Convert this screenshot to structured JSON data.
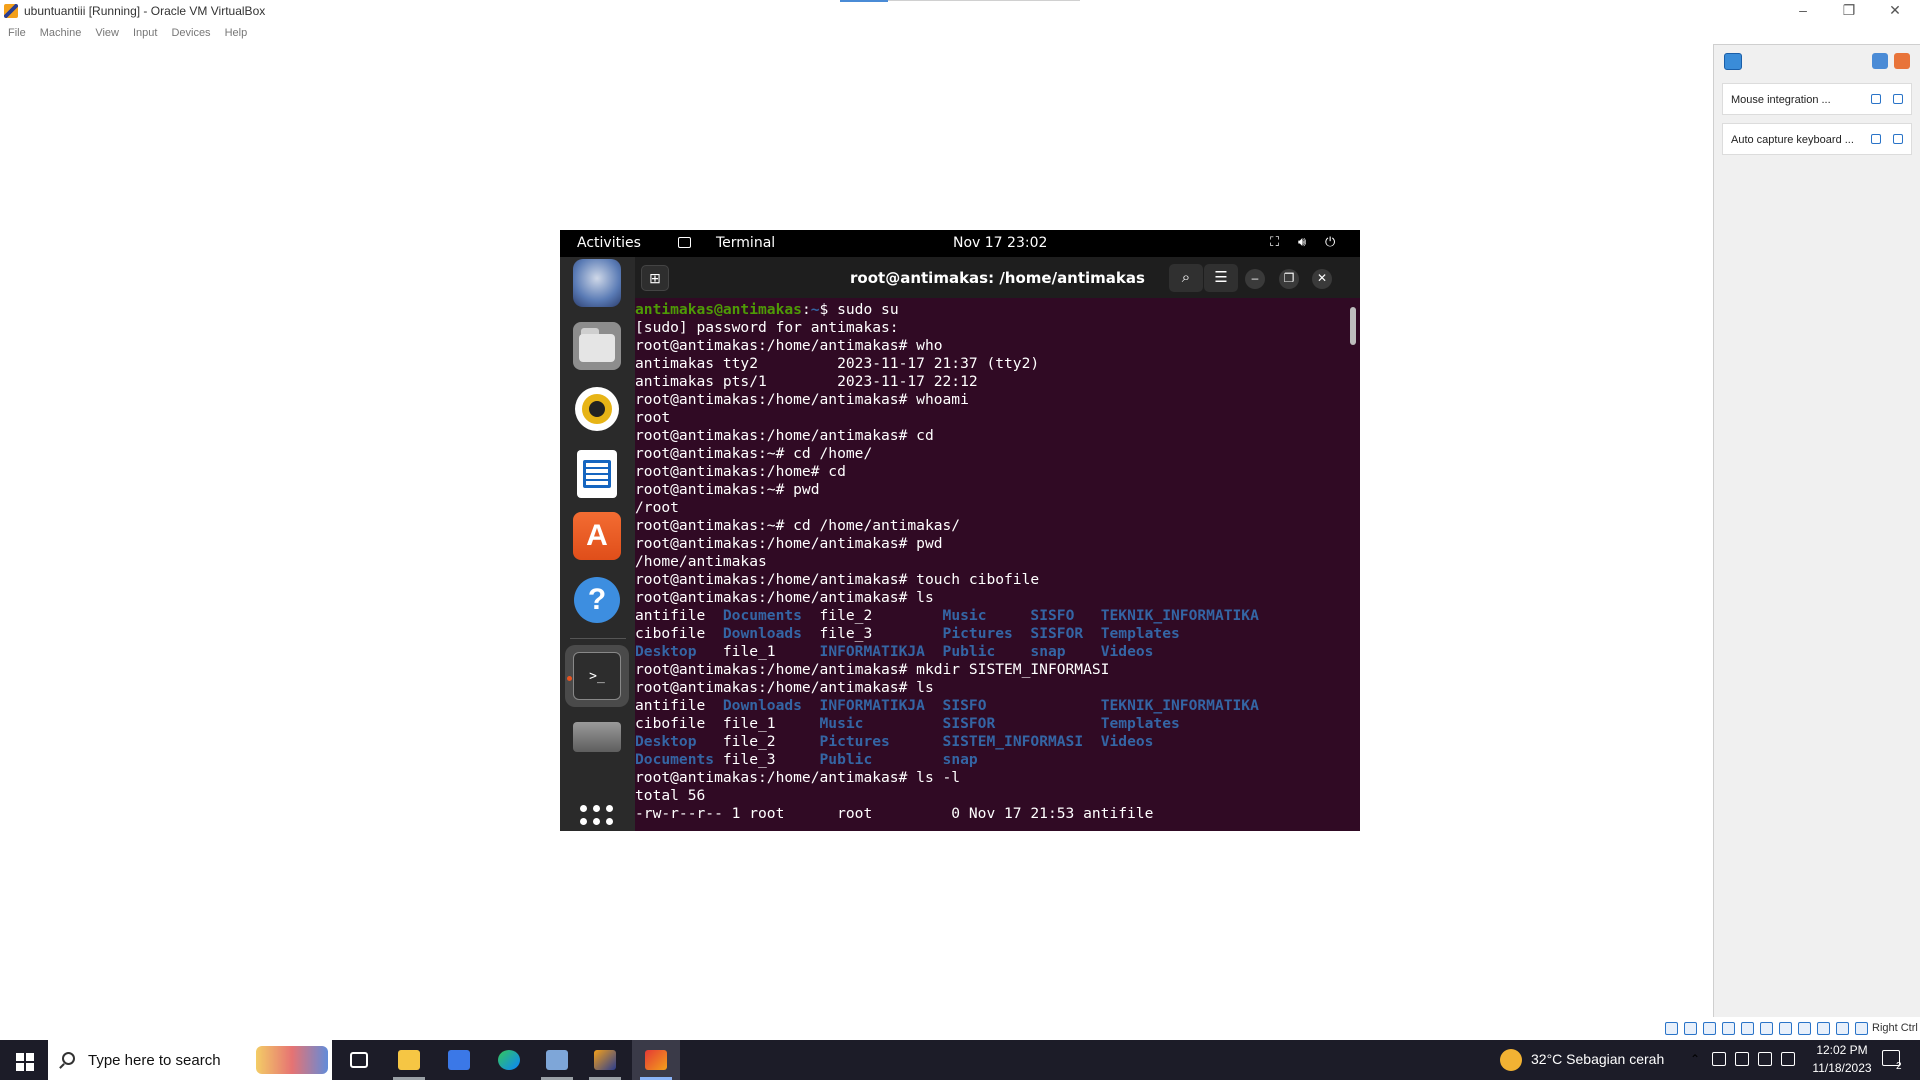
{
  "vbox": {
    "title": "ubuntuantiii [Running] - Oracle VM VirtualBox",
    "window_controls": {
      "minimize": "–",
      "restore": "❐",
      "close": "✕"
    },
    "menus": [
      "File",
      "Machine",
      "View",
      "Input",
      "Devices",
      "Help"
    ],
    "notifications": [
      {
        "label": "Mouse integration ..."
      },
      {
        "label": "Auto capture keyboard ..."
      }
    ],
    "host_key": "Right Ctrl"
  },
  "gnome": {
    "activities": "Activities",
    "app_menu": "Terminal",
    "clock": "Nov 17  23:02",
    "icons": [
      "network-icon",
      "volume-icon",
      "power-icon"
    ]
  },
  "dock": {
    "items": [
      "thunderbird-icon",
      "files-icon",
      "rhythmbox-icon",
      "libreoffice-writer-icon",
      "app-center-icon",
      "help-icon",
      "terminal-icon",
      "drive-icon",
      "show-apps-icon"
    ],
    "help_glyph": "?",
    "appcenter_glyph": "A",
    "terminal_glyph": ">_"
  },
  "terminal": {
    "title": "root@antimakas: /home/antimakas",
    "lines": [
      [
        {
          "t": "antimakas@antimakas",
          "c": "user"
        },
        {
          "t": ":"
        },
        {
          "t": "~",
          "c": "path"
        },
        {
          "t": "$ sudo su"
        }
      ],
      [
        {
          "t": "[sudo] password for antimakas:"
        }
      ],
      [
        {
          "t": "root@antimakas:/home/antimakas# who"
        }
      ],
      [
        {
          "t": "antimakas tty2         2023-11-17 21:37 (tty2)"
        }
      ],
      [
        {
          "t": "antimakas pts/1        2023-11-17 22:12"
        }
      ],
      [
        {
          "t": "root@antimakas:/home/antimakas# whoami"
        }
      ],
      [
        {
          "t": "root"
        }
      ],
      [
        {
          "t": "root@antimakas:/home/antimakas# cd"
        }
      ],
      [
        {
          "t": "root@antimakas:~# cd /home/"
        }
      ],
      [
        {
          "t": "root@antimakas:/home# cd"
        }
      ],
      [
        {
          "t": "root@antimakas:~# pwd"
        }
      ],
      [
        {
          "t": "/root"
        }
      ],
      [
        {
          "t": "root@antimakas:~# cd /home/antimakas/"
        }
      ],
      [
        {
          "t": "root@antimakas:/home/antimakas# pwd"
        }
      ],
      [
        {
          "t": "/home/antimakas"
        }
      ],
      [
        {
          "t": "root@antimakas:/home/antimakas# touch cibofile"
        }
      ],
      [
        {
          "t": "root@antimakas:/home/antimakas# ls"
        }
      ],
      [
        {
          "t": "antifile  "
        },
        {
          "t": "Documents",
          "c": "dir"
        },
        {
          "t": "  file_2        "
        },
        {
          "t": "Music",
          "c": "dir"
        },
        {
          "t": "     "
        },
        {
          "t": "SISFO",
          "c": "dir"
        },
        {
          "t": "   "
        },
        {
          "t": "TEKNIK_INFORMATIKA",
          "c": "dir"
        }
      ],
      [
        {
          "t": "cibofile  "
        },
        {
          "t": "Downloads",
          "c": "dir"
        },
        {
          "t": "  file_3        "
        },
        {
          "t": "Pictures",
          "c": "dir"
        },
        {
          "t": "  "
        },
        {
          "t": "SISFOR",
          "c": "dir"
        },
        {
          "t": "  "
        },
        {
          "t": "Templates",
          "c": "dir"
        }
      ],
      [
        {
          "t": "Desktop",
          "c": "dir"
        },
        {
          "t": "   file_1     "
        },
        {
          "t": "INFORMATIKJA",
          "c": "dir"
        },
        {
          "t": "  "
        },
        {
          "t": "Public",
          "c": "dir"
        },
        {
          "t": "    "
        },
        {
          "t": "snap",
          "c": "dir"
        },
        {
          "t": "    "
        },
        {
          "t": "Videos",
          "c": "dir"
        }
      ],
      [
        {
          "t": "root@antimakas:/home/antimakas# mkdir SISTEM_INFORMASI"
        }
      ],
      [
        {
          "t": "root@antimakas:/home/antimakas# ls"
        }
      ],
      [
        {
          "t": "antifile  "
        },
        {
          "t": "Downloads",
          "c": "dir"
        },
        {
          "t": "  "
        },
        {
          "t": "INFORMATIKJA",
          "c": "dir"
        },
        {
          "t": "  "
        },
        {
          "t": "SISFO",
          "c": "dir"
        },
        {
          "t": "             "
        },
        {
          "t": "TEKNIK_INFORMATIKA",
          "c": "dir"
        }
      ],
      [
        {
          "t": "cibofile  file_1     "
        },
        {
          "t": "Music",
          "c": "dir"
        },
        {
          "t": "         "
        },
        {
          "t": "SISFOR",
          "c": "dir"
        },
        {
          "t": "            "
        },
        {
          "t": "Templates",
          "c": "dir"
        }
      ],
      [
        {
          "t": "Desktop",
          "c": "dir"
        },
        {
          "t": "   file_2     "
        },
        {
          "t": "Pictures",
          "c": "dir"
        },
        {
          "t": "      "
        },
        {
          "t": "SISTEM_INFORMASI",
          "c": "dir"
        },
        {
          "t": "  "
        },
        {
          "t": "Videos",
          "c": "dir"
        }
      ],
      [
        {
          "t": "Documents",
          "c": "dir"
        },
        {
          "t": " file_3     "
        },
        {
          "t": "Public",
          "c": "dir"
        },
        {
          "t": "        "
        },
        {
          "t": "snap",
          "c": "dir"
        }
      ],
      [
        {
          "t": "root@antimakas:/home/antimakas# ls -l"
        }
      ],
      [
        {
          "t": "total 56"
        }
      ],
      [
        {
          "t": "-rw-r--r-- 1 root      root         0 Nov 17 21:53 antifile"
        }
      ]
    ]
  },
  "taskbar": {
    "search_placeholder": "Type here to search",
    "apps": [
      "task-view-icon",
      "file-explorer-icon",
      "system-app-icon",
      "edge-icon",
      "virtualbox-icon",
      "vm-app-icon",
      "active-vm-icon"
    ],
    "weather": "32°C  Sebagian cerah",
    "time": "12:02 PM",
    "date": "11/18/2023",
    "notification_count": "2"
  },
  "colors": {
    "terminal_bg": "#300a24",
    "user_prompt": "#4e9a06",
    "directory": "#3465a4",
    "taskbar_bg": "#1c1c28"
  }
}
